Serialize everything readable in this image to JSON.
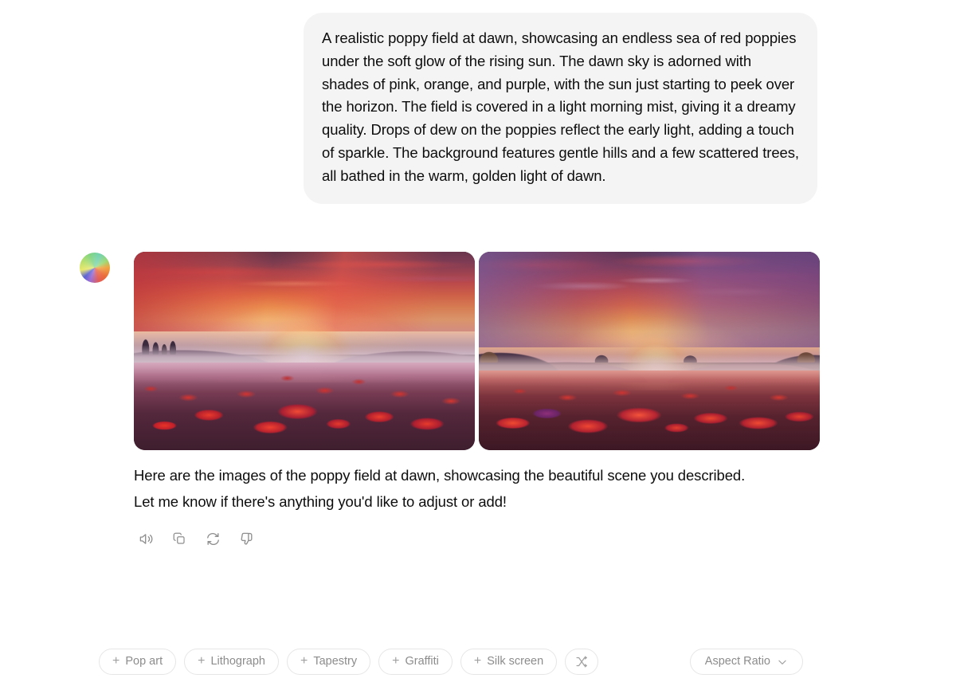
{
  "conversation": {
    "user_message": {
      "text": "A realistic poppy field at dawn, showcasing an endless sea of red poppies under the soft glow of the rising sun. The dawn sky is adorned with shades of pink, orange, and purple, with the sun just starting to peek over the horizon. The field is covered in a light morning mist, giving it a dreamy quality. Drops of dew on the poppies reflect the early light, adding a touch of sparkle. The background features gentle hills and a few scattered trees, all bathed in the warm, golden light of dawn."
    },
    "assistant_message": {
      "avatar_icon": "color-wheel-avatar-icon",
      "images": [
        {
          "alt": "Poppy field at dawn with sun rising over misty hills and cypress trees",
          "index": 1
        },
        {
          "alt": "Poppy field at sunset with purple and red clouds over rolling hills",
          "index": 2
        }
      ],
      "paragraphs": [
        "Here are the images of the poppy field at dawn, showcasing the beautiful scene you described.",
        "Let me know if there's anything you'd like to adjust or add!"
      ],
      "actions": [
        {
          "icon": "speaker-read-aloud-icon",
          "label": "Read aloud"
        },
        {
          "icon": "copy-icon",
          "label": "Copy"
        },
        {
          "icon": "regenerate-icon",
          "label": "Regenerate"
        },
        {
          "icon": "thumbs-down-icon",
          "label": "Bad response"
        }
      ]
    }
  },
  "bottom_bar": {
    "style_chips": [
      {
        "prefix": "+",
        "label": "Pop art"
      },
      {
        "prefix": "+",
        "label": "Lithograph"
      },
      {
        "prefix": "+",
        "label": "Tapestry"
      },
      {
        "prefix": "+",
        "label": "Graffiti"
      },
      {
        "prefix": "+",
        "label": "Silk screen"
      }
    ],
    "shuffle_button": {
      "icon": "shuffle-icon",
      "label": "Shuffle styles"
    },
    "aspect_ratio_button": {
      "label": "Aspect Ratio",
      "icon": "chevron-down-icon"
    }
  },
  "colors": {
    "page_background": "#ffffff",
    "bubble_background": "#f4f4f4",
    "text_primary": "#0d0d0d",
    "chip_border": "#e6e6e6",
    "chip_text": "#8c8c8c",
    "icon_gray": "#8f8f8f"
  }
}
